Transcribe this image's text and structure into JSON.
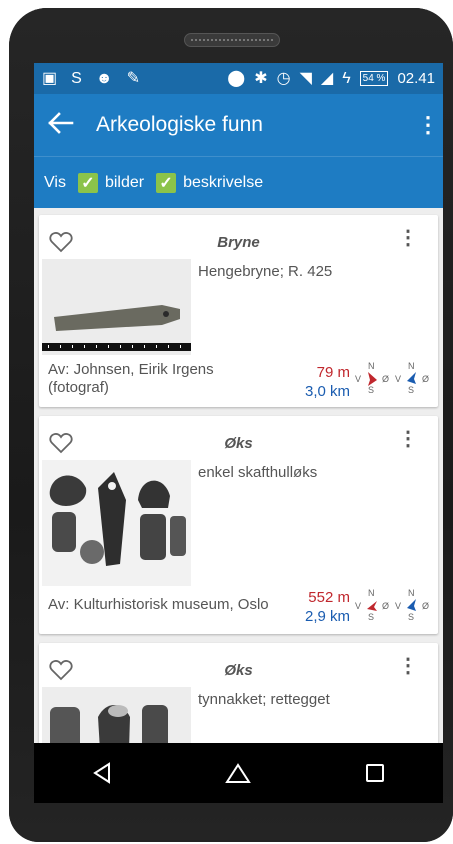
{
  "status": {
    "time": "02.41",
    "battery": "54 %"
  },
  "appbar": {
    "title": "Arkeologiske funn"
  },
  "filter": {
    "label": "Vis",
    "options": [
      {
        "label": "bilder",
        "checked": true
      },
      {
        "label": "beskrivelse",
        "checked": true
      }
    ]
  },
  "cards": [
    {
      "title": "Bryne",
      "description": "Hengebryne; R. 425",
      "byline": "Av: Johnsen, Eirik Irgens (fotograf)",
      "distance_m": "79 m",
      "distance_km": "3,0 km"
    },
    {
      "title": "Øks",
      "description": "enkel skafthulløks",
      "byline": "Av: Kulturhistorisk museum, Oslo",
      "distance_m": "552 m",
      "distance_km": "2,9 km"
    },
    {
      "title": "Øks",
      "description": "tynnakket; rettegget"
    }
  ],
  "compass_labels": {
    "n": "N",
    "s": "S",
    "v": "V",
    "o": "Ø"
  },
  "colors": {
    "appbar": "#1e7cc3",
    "statusbar": "#1a6aa8",
    "checkbox": "#8bc34a",
    "distance_m": "#c0272d",
    "distance_km": "#1a5cb0"
  }
}
